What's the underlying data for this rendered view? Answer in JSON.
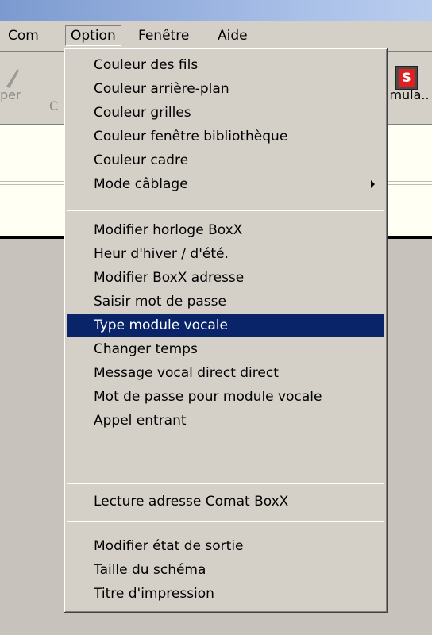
{
  "menubar": {
    "items": [
      {
        "label": "Com"
      },
      {
        "label": "Option"
      },
      {
        "label": "Fenêtre"
      },
      {
        "label": "Aide"
      }
    ]
  },
  "toolbar": {
    "left_label": "per",
    "left_label2": "C",
    "right_label": "imula..",
    "right_icon": "simulation-icon",
    "right_icon_letter": "S"
  },
  "option_menu": {
    "items": [
      {
        "label": "Couleur des fils"
      },
      {
        "label": "Couleur arrière-plan"
      },
      {
        "label": "Couleur grilles"
      },
      {
        "label": "Couleur fenêtre bibliothèque"
      },
      {
        "label": "Couleur cadre"
      },
      {
        "label": "Mode câblage",
        "submenu": true
      },
      {
        "label": "Modifier horloge BoxX"
      },
      {
        "label": "Heur d'hiver / d'été."
      },
      {
        "label": "Modifier BoxX adresse"
      },
      {
        "label": "Saisir mot de passe"
      },
      {
        "label": "Type module vocale",
        "highlighted": true
      },
      {
        "label": "Changer temps"
      },
      {
        "label": "Message vocal direct direct"
      },
      {
        "label": "Mot de passe pour module vocale"
      },
      {
        "label": "Appel entrant"
      },
      {
        "label": "Lecture adresse Comat BoxX"
      },
      {
        "label": "Modifier état de sortie"
      },
      {
        "label": "Taille du schéma"
      },
      {
        "label": "Titre d'impression"
      }
    ]
  },
  "colors": {
    "menu_background": "#d4d0c8",
    "highlight": "#0a246a",
    "highlight_text": "#ffffff",
    "titlebar": "#a9c0e8",
    "panel": "#fffff4"
  }
}
